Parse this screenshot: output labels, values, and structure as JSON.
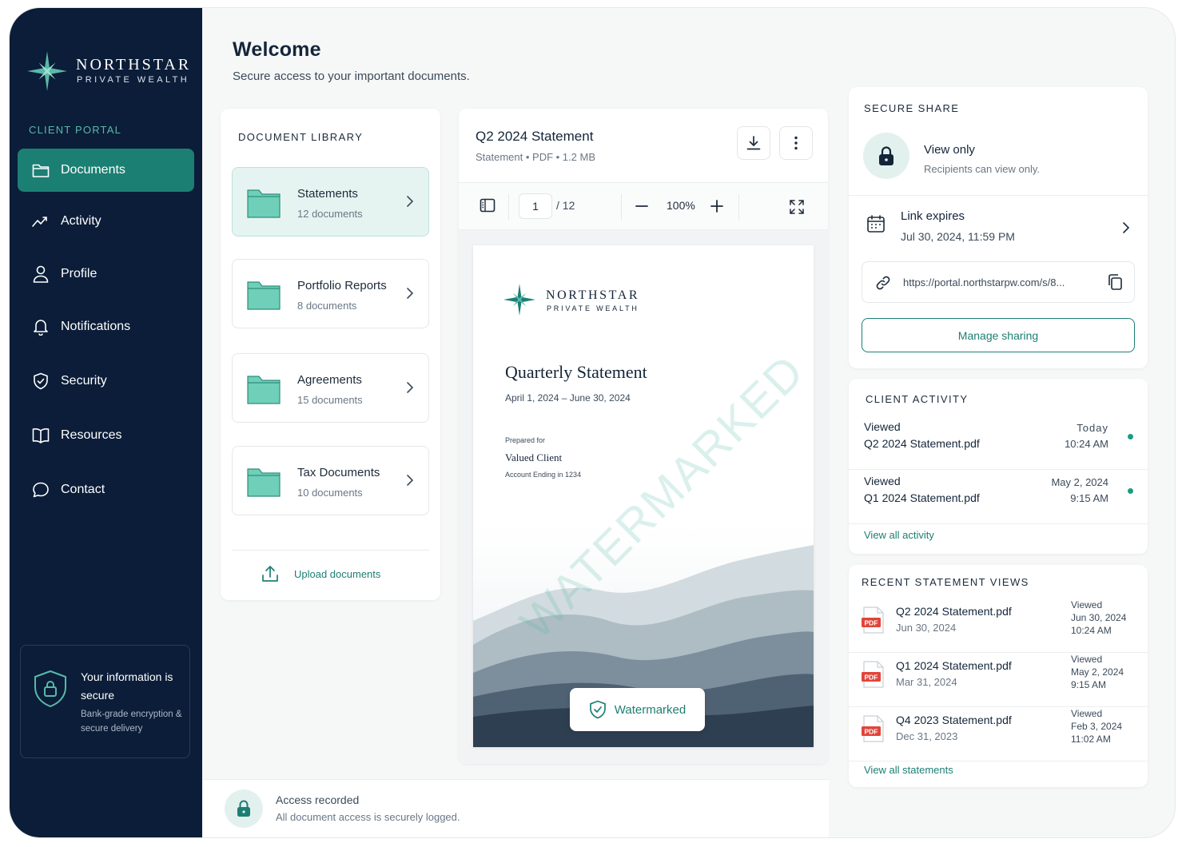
{
  "brand": {
    "name": "NORTHSTAR",
    "sub": "PRIVATE WEALTH",
    "portal_label": "CLIENT PORTAL"
  },
  "sidebar": {
    "items": [
      {
        "label": "Documents",
        "icon": "folder-icon",
        "active": true
      },
      {
        "label": "Activity",
        "icon": "trend-icon",
        "active": false
      },
      {
        "label": "Profile",
        "icon": "person-icon",
        "active": false
      },
      {
        "label": "Notifications",
        "icon": "bell-icon",
        "active": false
      },
      {
        "label": "Security",
        "icon": "shield-icon",
        "active": false
      },
      {
        "label": "Resources",
        "icon": "book-icon",
        "active": false
      },
      {
        "label": "Contact",
        "icon": "chat-icon",
        "active": false
      }
    ],
    "secure": {
      "title": "Your information is secure",
      "subtitle": "Bank-grade encryption & secure delivery"
    }
  },
  "header": {
    "title": "Welcome",
    "subtitle": "Secure access to your important documents."
  },
  "library": {
    "title": "DOCUMENT LIBRARY",
    "folders": [
      {
        "name": "Statements",
        "count": "12 documents",
        "selected": true
      },
      {
        "name": "Portfolio Reports",
        "count": "8 documents",
        "selected": false
      },
      {
        "name": "Agreements",
        "count": "15 documents",
        "selected": false
      },
      {
        "name": "Tax Documents",
        "count": "10 documents",
        "selected": false
      }
    ],
    "upload_label": "Upload documents"
  },
  "viewer": {
    "title": "Q2 2024 Statement",
    "meta": "Statement • PDF • 1.2 MB",
    "page_current": "1",
    "page_total": "/ 12",
    "zoom": "100%",
    "preview": {
      "brand_name": "NORTHSTAR",
      "brand_sub": "PRIVATE WEALTH",
      "title": "Quarterly Statement",
      "range": "April 1, 2024 – June 30, 2024",
      "prepared_for_label": "Prepared for",
      "client": "Valued Client",
      "account": "Account Ending in 1234",
      "watermark": "WATERMARKED",
      "badge": "Watermarked"
    }
  },
  "access": {
    "title": "Access recorded",
    "subtitle": "All document access is securely logged."
  },
  "share": {
    "title": "SECURE SHARE",
    "mode": "View only",
    "mode_sub": "Recipients can view only.",
    "expires_label": "Link expires",
    "expires_date": "Jul 30, 2024, 11:59 PM",
    "link": "https://portal.northstarpw.com/s/8...",
    "manage_label": "Manage sharing"
  },
  "activity": {
    "title": "CLIENT ACTIVITY",
    "rows": [
      {
        "verb": "Viewed",
        "file": "Q2 2024 Statement.pdf",
        "date": "Today",
        "time": "10:24 AM"
      },
      {
        "verb": "Viewed",
        "file": "Q1 2024 Statement.pdf",
        "date": "May 2, 2024",
        "time": "9:15 AM"
      }
    ],
    "link": "View all activity"
  },
  "recent": {
    "title": "RECENT STATEMENT VIEWS",
    "rows": [
      {
        "name": "Q2 2024 Statement.pdf",
        "date": "Jun 30, 2024",
        "viewed": "Viewed",
        "viewed_date": "Jun 30, 2024",
        "viewed_time": "10:24 AM",
        "badge": "PDF"
      },
      {
        "name": "Q1 2024 Statement.pdf",
        "date": "Mar 31, 2024",
        "viewed": "Viewed",
        "viewed_date": "May 2, 2024",
        "viewed_time": "9:15 AM",
        "badge": "PDF"
      },
      {
        "name": "Q4 2023 Statement.pdf",
        "date": "Dec 31, 2023",
        "viewed": "Viewed",
        "viewed_date": "Feb 3, 2024",
        "viewed_time": "11:02 AM",
        "badge": "PDF"
      }
    ],
    "link": "View all statements"
  },
  "colors": {
    "sidebar": "#0b1d38",
    "accent": "#1c7f73",
    "accent_light": "#58b9a8",
    "folder": "#6fcfb8",
    "pdf": "#e0453a"
  }
}
